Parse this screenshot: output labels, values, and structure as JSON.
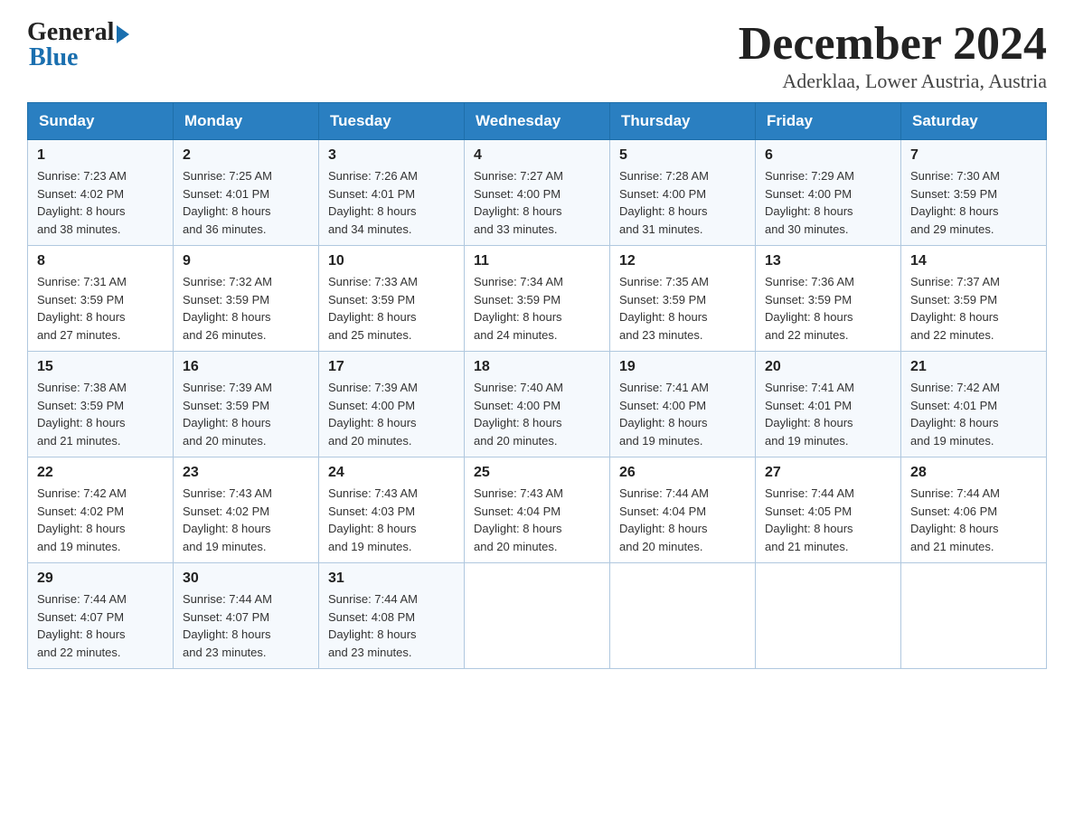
{
  "header": {
    "logo_general": "General",
    "logo_blue": "Blue",
    "month_title": "December 2024",
    "location": "Aderklaa, Lower Austria, Austria"
  },
  "days_of_week": [
    "Sunday",
    "Monday",
    "Tuesday",
    "Wednesday",
    "Thursday",
    "Friday",
    "Saturday"
  ],
  "weeks": [
    [
      {
        "day": "1",
        "sunrise": "7:23 AM",
        "sunset": "4:02 PM",
        "daylight": "8 hours and 38 minutes."
      },
      {
        "day": "2",
        "sunrise": "7:25 AM",
        "sunset": "4:01 PM",
        "daylight": "8 hours and 36 minutes."
      },
      {
        "day": "3",
        "sunrise": "7:26 AM",
        "sunset": "4:01 PM",
        "daylight": "8 hours and 34 minutes."
      },
      {
        "day": "4",
        "sunrise": "7:27 AM",
        "sunset": "4:00 PM",
        "daylight": "8 hours and 33 minutes."
      },
      {
        "day": "5",
        "sunrise": "7:28 AM",
        "sunset": "4:00 PM",
        "daylight": "8 hours and 31 minutes."
      },
      {
        "day": "6",
        "sunrise": "7:29 AM",
        "sunset": "4:00 PM",
        "daylight": "8 hours and 30 minutes."
      },
      {
        "day": "7",
        "sunrise": "7:30 AM",
        "sunset": "3:59 PM",
        "daylight": "8 hours and 29 minutes."
      }
    ],
    [
      {
        "day": "8",
        "sunrise": "7:31 AM",
        "sunset": "3:59 PM",
        "daylight": "8 hours and 27 minutes."
      },
      {
        "day": "9",
        "sunrise": "7:32 AM",
        "sunset": "3:59 PM",
        "daylight": "8 hours and 26 minutes."
      },
      {
        "day": "10",
        "sunrise": "7:33 AM",
        "sunset": "3:59 PM",
        "daylight": "8 hours and 25 minutes."
      },
      {
        "day": "11",
        "sunrise": "7:34 AM",
        "sunset": "3:59 PM",
        "daylight": "8 hours and 24 minutes."
      },
      {
        "day": "12",
        "sunrise": "7:35 AM",
        "sunset": "3:59 PM",
        "daylight": "8 hours and 23 minutes."
      },
      {
        "day": "13",
        "sunrise": "7:36 AM",
        "sunset": "3:59 PM",
        "daylight": "8 hours and 22 minutes."
      },
      {
        "day": "14",
        "sunrise": "7:37 AM",
        "sunset": "3:59 PM",
        "daylight": "8 hours and 22 minutes."
      }
    ],
    [
      {
        "day": "15",
        "sunrise": "7:38 AM",
        "sunset": "3:59 PM",
        "daylight": "8 hours and 21 minutes."
      },
      {
        "day": "16",
        "sunrise": "7:39 AM",
        "sunset": "3:59 PM",
        "daylight": "8 hours and 20 minutes."
      },
      {
        "day": "17",
        "sunrise": "7:39 AM",
        "sunset": "4:00 PM",
        "daylight": "8 hours and 20 minutes."
      },
      {
        "day": "18",
        "sunrise": "7:40 AM",
        "sunset": "4:00 PM",
        "daylight": "8 hours and 20 minutes."
      },
      {
        "day": "19",
        "sunrise": "7:41 AM",
        "sunset": "4:00 PM",
        "daylight": "8 hours and 19 minutes."
      },
      {
        "day": "20",
        "sunrise": "7:41 AM",
        "sunset": "4:01 PM",
        "daylight": "8 hours and 19 minutes."
      },
      {
        "day": "21",
        "sunrise": "7:42 AM",
        "sunset": "4:01 PM",
        "daylight": "8 hours and 19 minutes."
      }
    ],
    [
      {
        "day": "22",
        "sunrise": "7:42 AM",
        "sunset": "4:02 PM",
        "daylight": "8 hours and 19 minutes."
      },
      {
        "day": "23",
        "sunrise": "7:43 AM",
        "sunset": "4:02 PM",
        "daylight": "8 hours and 19 minutes."
      },
      {
        "day": "24",
        "sunrise": "7:43 AM",
        "sunset": "4:03 PM",
        "daylight": "8 hours and 19 minutes."
      },
      {
        "day": "25",
        "sunrise": "7:43 AM",
        "sunset": "4:04 PM",
        "daylight": "8 hours and 20 minutes."
      },
      {
        "day": "26",
        "sunrise": "7:44 AM",
        "sunset": "4:04 PM",
        "daylight": "8 hours and 20 minutes."
      },
      {
        "day": "27",
        "sunrise": "7:44 AM",
        "sunset": "4:05 PM",
        "daylight": "8 hours and 21 minutes."
      },
      {
        "day": "28",
        "sunrise": "7:44 AM",
        "sunset": "4:06 PM",
        "daylight": "8 hours and 21 minutes."
      }
    ],
    [
      {
        "day": "29",
        "sunrise": "7:44 AM",
        "sunset": "4:07 PM",
        "daylight": "8 hours and 22 minutes."
      },
      {
        "day": "30",
        "sunrise": "7:44 AM",
        "sunset": "4:07 PM",
        "daylight": "8 hours and 23 minutes."
      },
      {
        "day": "31",
        "sunrise": "7:44 AM",
        "sunset": "4:08 PM",
        "daylight": "8 hours and 23 minutes."
      },
      null,
      null,
      null,
      null
    ]
  ],
  "labels": {
    "sunrise": "Sunrise:",
    "sunset": "Sunset:",
    "daylight": "Daylight:"
  }
}
